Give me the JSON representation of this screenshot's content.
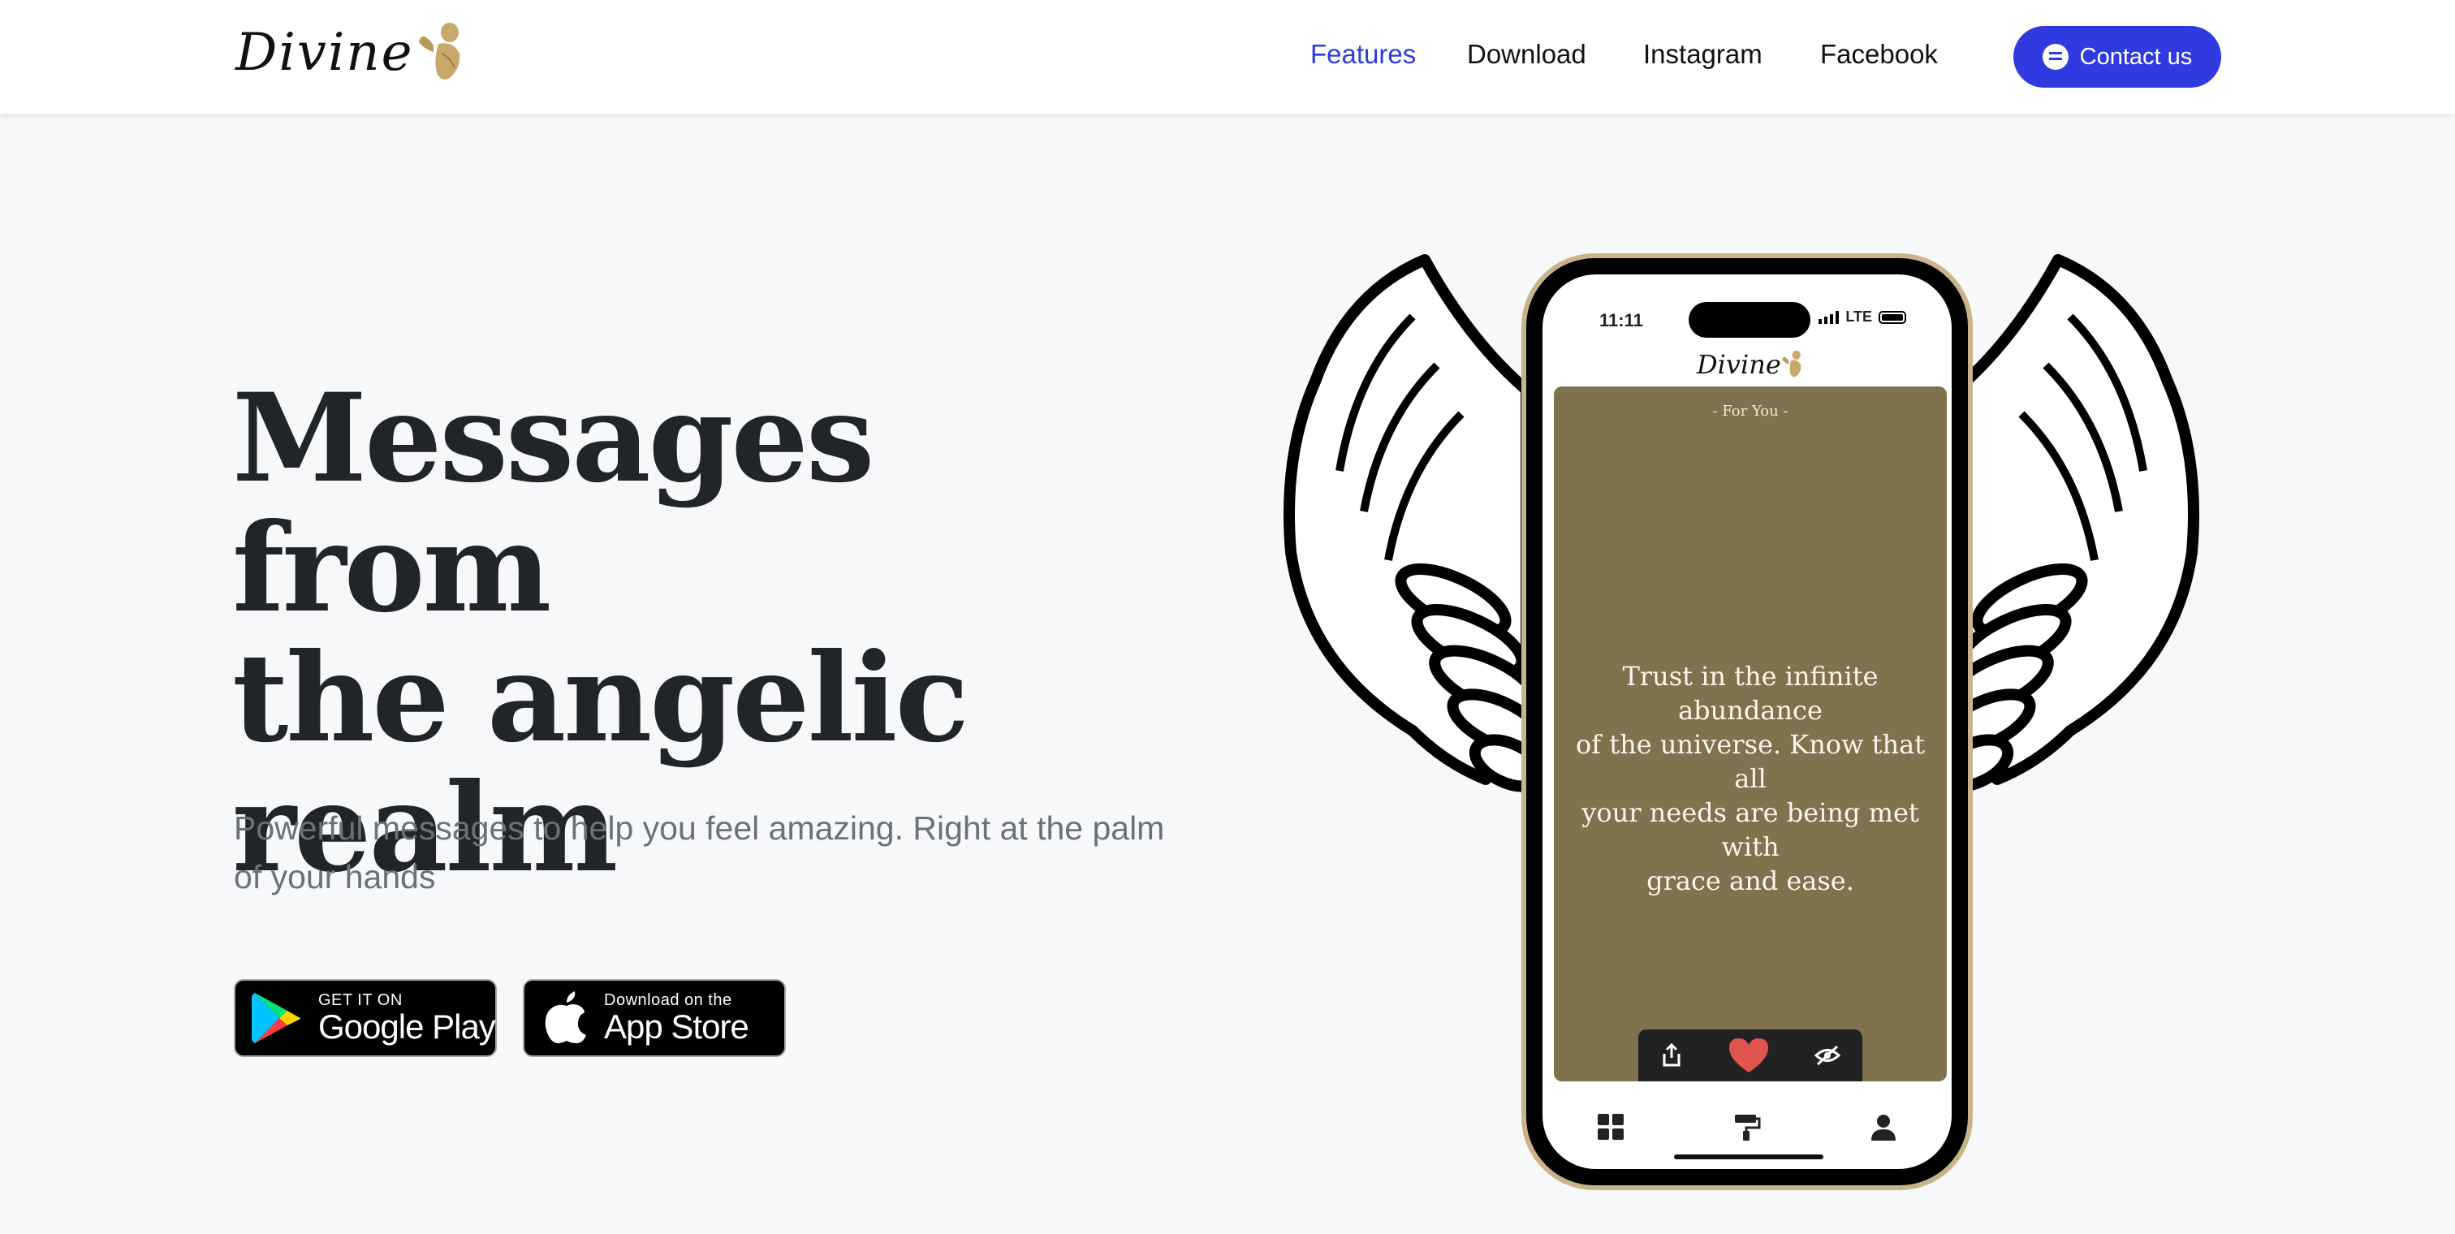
{
  "brand": {
    "name": "Divine"
  },
  "nav": {
    "links": [
      {
        "label": "Features",
        "active": true
      },
      {
        "label": "Download",
        "active": false
      },
      {
        "label": "Instagram",
        "active": false
      },
      {
        "label": "Facebook",
        "active": false
      }
    ],
    "contact_label": "Contact us",
    "accent_color": "#2f3be0"
  },
  "hero": {
    "title_lines": [
      "Messages from",
      "the angelic",
      "realm"
    ],
    "subtitle_lines": [
      "Powerful messages to help you feel amazing. Right at the palm",
      "of your hands"
    ]
  },
  "stores": {
    "google": {
      "small": "GET IT ON",
      "big": "Google Play",
      "icon": "google-play-icon"
    },
    "apple": {
      "small": "Download on the",
      "big": "App Store",
      "icon": "apple-icon"
    }
  },
  "phone": {
    "status_time": "11:11",
    "network": "LTE",
    "app_name": "Divine",
    "card_label": "- For You -",
    "card_color": "#7f724e",
    "quote_lines": [
      "Trust in the infinite abundance",
      "of the universe. Know that all",
      "your needs are being met with",
      "grace and ease."
    ],
    "actions": [
      "share-icon",
      "heart-icon",
      "hide-icon"
    ],
    "tabs": [
      "grid-icon",
      "paint-roller-icon",
      "profile-icon"
    ]
  }
}
